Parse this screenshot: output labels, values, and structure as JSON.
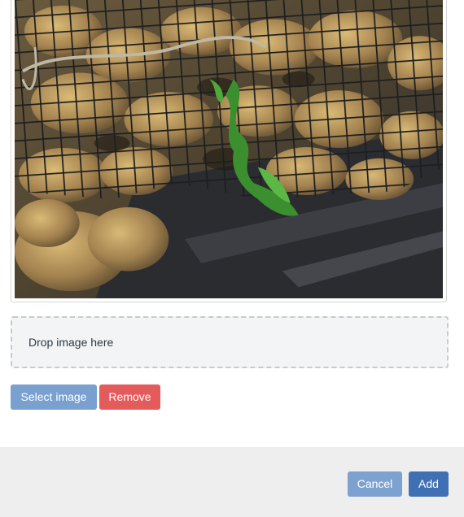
{
  "preview": {
    "image_alt": "oysters in mesh cage with seaweed"
  },
  "dropzone": {
    "text": "Drop image here"
  },
  "actions": {
    "select_label": "Select image",
    "remove_label": "Remove"
  },
  "footer": {
    "cancel_label": "Cancel",
    "add_label": "Add"
  },
  "colors": {
    "primary": "#3f70b4",
    "primary_light": "#79a0cf",
    "danger": "#e35b5b",
    "dropzone_bg": "#f2f4f5",
    "footer_bg": "#eeeeee"
  }
}
